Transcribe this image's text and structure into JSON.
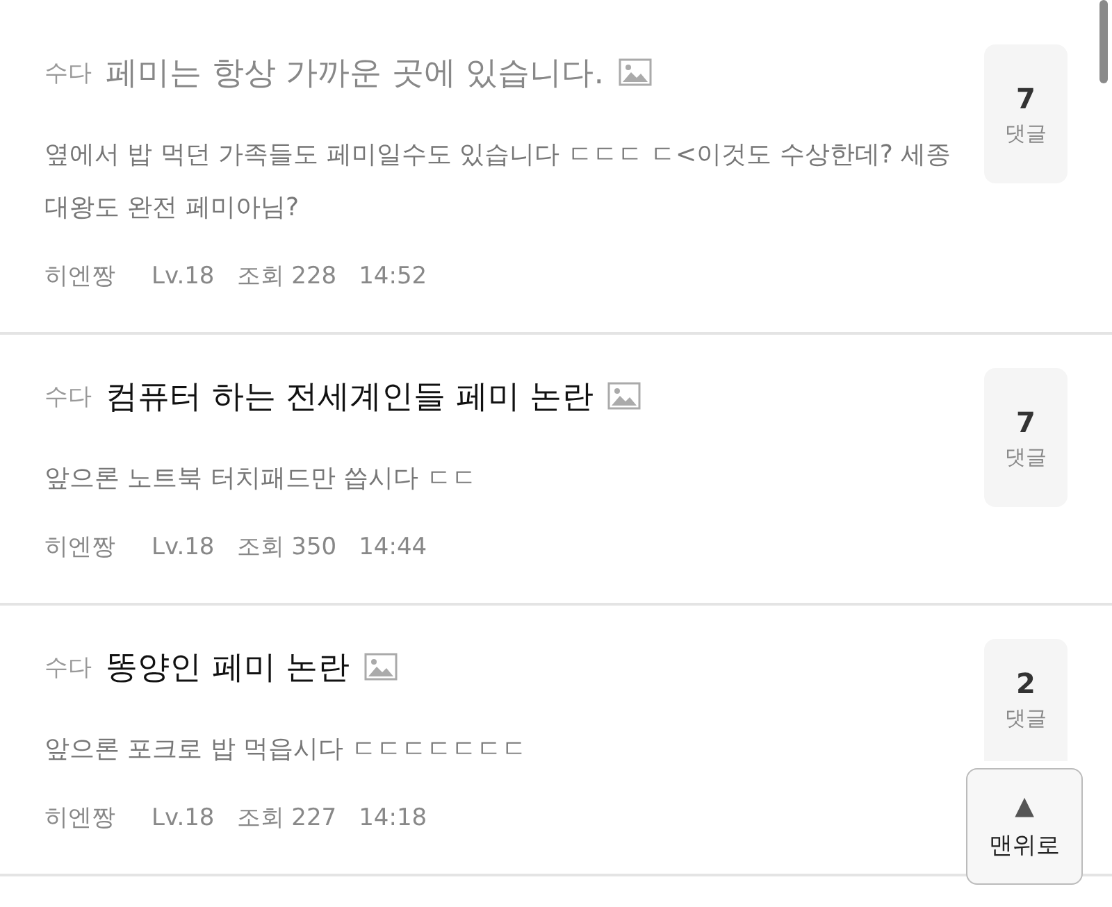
{
  "posts": [
    {
      "category": "수다",
      "title": "페미는 항상 가까운 곳에 있습니다.",
      "visited": true,
      "has_image": true,
      "preview": "옆에서 밥 먹던 가족들도 페미일수도 있습니다 ㄷㄷㄷ ㄷ<이것도 수상한데? 세종대왕도 완전 페미아님?",
      "author": "히엔짱",
      "level": "Lv.18",
      "views": "조회 228",
      "time": "14:52",
      "comments": "7",
      "comments_label": "댓글"
    },
    {
      "category": "수다",
      "title": "컴퓨터 하는 전세계인들 페미 논란",
      "visited": false,
      "has_image": true,
      "preview": "앞으론 노트북 터치패드만 씁시다 ㄷㄷ",
      "author": "히엔짱",
      "level": "Lv.18",
      "views": "조회 350",
      "time": "14:44",
      "comments": "7",
      "comments_label": "댓글"
    },
    {
      "category": "수다",
      "title": "똥양인 페미 논란",
      "visited": false,
      "has_image": true,
      "preview": "앞으론 포크로 밥 먹읍시다 ㄷㄷㄷㄷㄷㄷㄷ",
      "author": "히엔짱",
      "level": "Lv.18",
      "views": "조회 227",
      "time": "14:18",
      "comments": "2",
      "comments_label": "댓글"
    }
  ],
  "top_button": {
    "arrow": "▲",
    "label": "맨위로"
  }
}
